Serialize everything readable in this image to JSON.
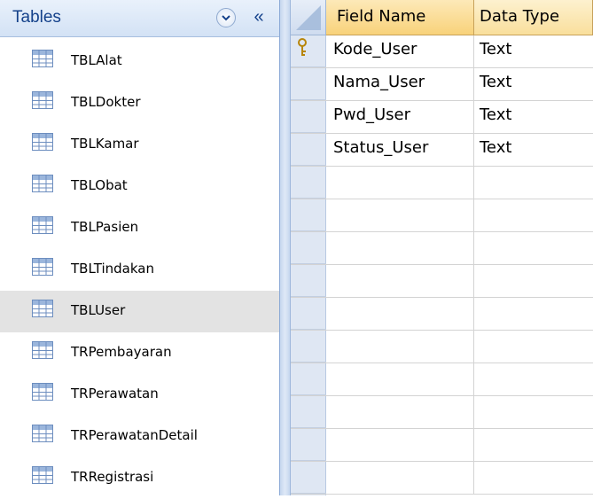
{
  "nav": {
    "title": "Tables",
    "collapse_label": "«",
    "items": [
      {
        "label": "TBLAlat"
      },
      {
        "label": "TBLDokter"
      },
      {
        "label": "TBLKamar"
      },
      {
        "label": "TBLObat"
      },
      {
        "label": "TBLPasien"
      },
      {
        "label": "TBLTindakan"
      },
      {
        "label": "TBLUser",
        "selected": true
      },
      {
        "label": "TRPembayaran"
      },
      {
        "label": "TRPerawatan"
      },
      {
        "label": "TRPerawatanDetail"
      },
      {
        "label": "TRRegistrasi"
      }
    ]
  },
  "grid": {
    "headers": {
      "field_name": "Field Name",
      "data_type": "Data Type"
    },
    "rows": [
      {
        "field": "Kode_User",
        "type": "Text",
        "primary_key": true
      },
      {
        "field": "Nama_User",
        "type": "Text"
      },
      {
        "field": "Pwd_User",
        "type": "Text"
      },
      {
        "field": "Status_User",
        "type": "Text"
      },
      {
        "field": "",
        "type": ""
      },
      {
        "field": "",
        "type": ""
      },
      {
        "field": "",
        "type": ""
      },
      {
        "field": "",
        "type": ""
      },
      {
        "field": "",
        "type": ""
      },
      {
        "field": "",
        "type": ""
      },
      {
        "field": "",
        "type": ""
      },
      {
        "field": "",
        "type": ""
      },
      {
        "field": "",
        "type": ""
      },
      {
        "field": "",
        "type": ""
      }
    ]
  },
  "colors": {
    "nav_title": "#15428b",
    "selected_item_bg": "#e3e3e3",
    "header_bg": "#f8d27a",
    "selector_bg": "#dfe7f3"
  },
  "icons": {
    "table": "table-icon",
    "dropdown": "chevron-down-icon",
    "collapse": "collapse-icon",
    "primary_key": "key-icon"
  }
}
